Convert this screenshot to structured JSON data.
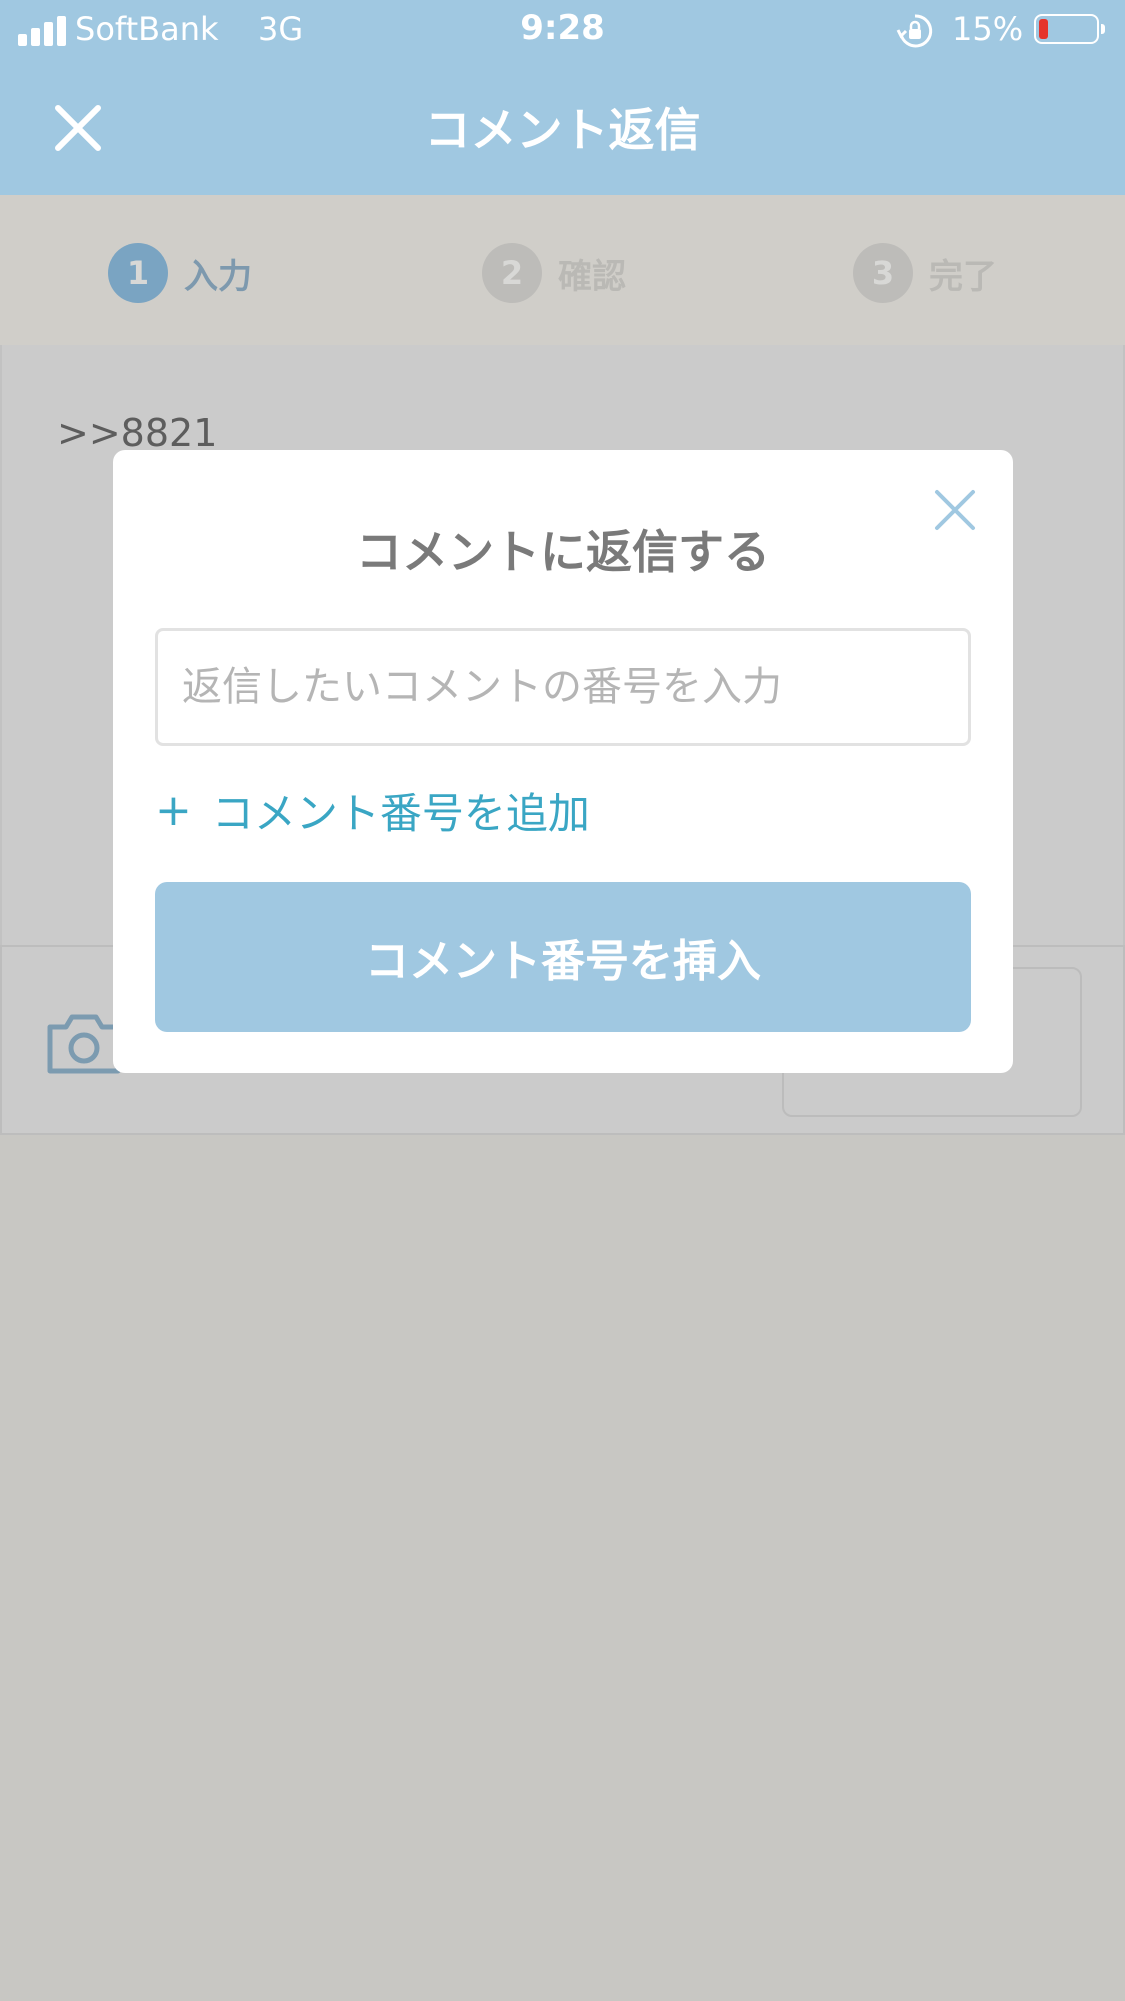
{
  "status_bar": {
    "carrier": "SoftBank",
    "network": "3G",
    "time": "9:28",
    "battery_percent": "15%",
    "battery_level": 0.15,
    "icons": [
      "signal-icon",
      "rotation-lock-icon",
      "battery-icon"
    ]
  },
  "nav": {
    "title": "コメント返信",
    "close_icon": "close-icon"
  },
  "steps": [
    {
      "number": "1",
      "label": "入力",
      "active": true
    },
    {
      "number": "2",
      "label": "確認",
      "active": false
    },
    {
      "number": "3",
      "label": "完了",
      "active": false
    }
  ],
  "content": {
    "reply_text": ">>8821"
  },
  "toolbar": {
    "camera_icon": "camera-icon"
  },
  "modal": {
    "title": "コメントに返信する",
    "input_placeholder": "返信したいコメントの番号を入力",
    "input_value": "",
    "add_link_label": "コメント番号を追加",
    "add_link_prefix": "+",
    "insert_button_label": "コメント番号を挿入",
    "close_icon": "close-icon"
  },
  "colors": {
    "brand": "#a0c8e1",
    "link": "#3aa6c4",
    "battery_low": "#e5342c",
    "backdrop": "#c8c7c3"
  }
}
